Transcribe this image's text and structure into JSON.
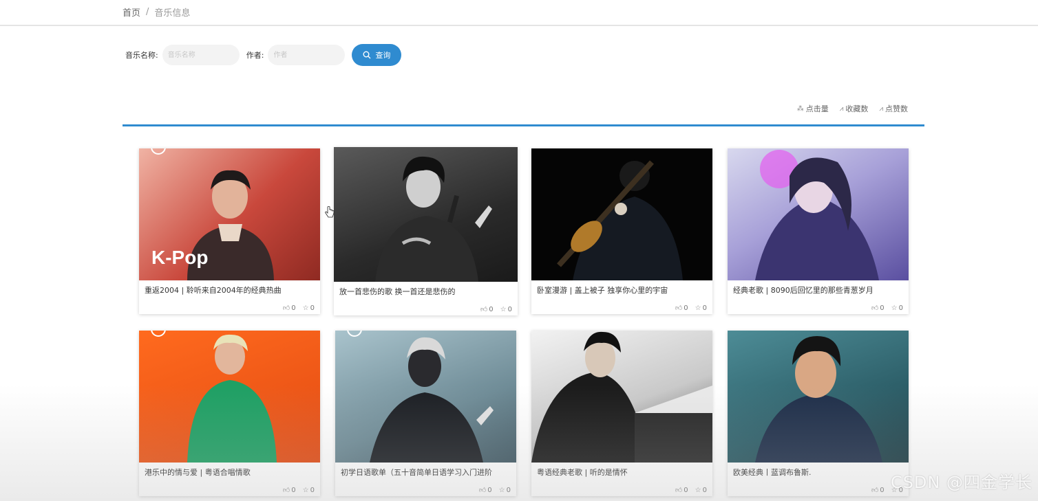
{
  "breadcrumb": {
    "home": "首页",
    "separator": "/",
    "current": "音乐信息"
  },
  "search": {
    "name_label": "音乐名称:",
    "name_placeholder": "音乐名称",
    "author_label": "作者:",
    "author_placeholder": "作者",
    "button_label": "查询"
  },
  "sort": [
    {
      "icon": "click-icon",
      "label": "点击量"
    },
    {
      "icon": "favorite-chart-icon",
      "label": "收藏数"
    },
    {
      "icon": "like-chart-icon",
      "label": "点赞数"
    }
  ],
  "cards": [
    {
      "title": "重返2004 | 聆听来自2004年的经典热曲",
      "likes": "0",
      "favorites": "0",
      "cover_text": "K-Pop"
    },
    {
      "title": "放一首悲伤的歌 换一首还是悲伤的",
      "likes": "0",
      "favorites": "0",
      "cover_text": ""
    },
    {
      "title": "卧室漫游 | 盖上被子 独享你心里的宇宙",
      "likes": "0",
      "favorites": "0",
      "cover_text": ""
    },
    {
      "title": "经典老歌 | 8090后回忆里的那些青葱岁月",
      "likes": "0",
      "favorites": "0",
      "cover_text": ""
    },
    {
      "title": "港乐中的情与爱 | 粤语合唱情歌",
      "likes": "0",
      "favorites": "0",
      "cover_text": ""
    },
    {
      "title": "初学日语歌单（五十音简单日语学习入门进阶",
      "likes": "0",
      "favorites": "0",
      "cover_text": ""
    },
    {
      "title": "粤语经典老歌 | 听的是情怀",
      "likes": "0",
      "favorites": "0",
      "cover_text": ""
    },
    {
      "title": "欧美经典丨蓝调布鲁斯.",
      "likes": "0",
      "favorites": "0",
      "cover_text": ""
    }
  ],
  "watermark": "CSDN @四金学长",
  "colors": {
    "accent": "#2f8bd0"
  }
}
